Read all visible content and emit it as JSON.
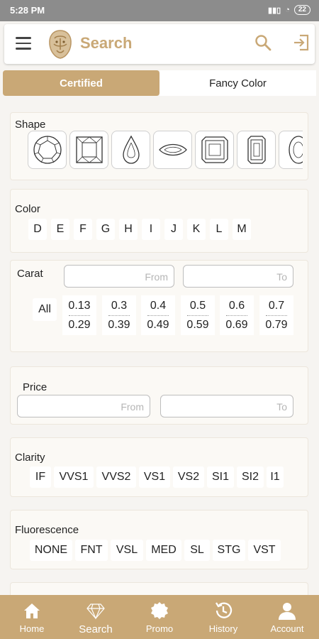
{
  "status": {
    "time": "5:28 PM",
    "battery": "22"
  },
  "header": {
    "title": "Search"
  },
  "tabs": [
    {
      "label": "Certified",
      "active": true
    },
    {
      "label": "Fancy Color",
      "active": false
    }
  ],
  "shape": {
    "label": "Shape",
    "items": [
      "round-icon",
      "princess-icon",
      "pear-icon",
      "marquise-icon",
      "asscher-icon",
      "emerald-icon",
      "oval-icon"
    ]
  },
  "color": {
    "label": "Color",
    "options": [
      "D",
      "E",
      "F",
      "G",
      "H",
      "I",
      "J",
      "K",
      "L",
      "M"
    ]
  },
  "carat": {
    "label": "Carat",
    "from_placeholder": "From",
    "to_placeholder": "To",
    "all_label": "All",
    "ranges": [
      {
        "from": "0.13",
        "to": "0.29"
      },
      {
        "from": "0.3",
        "to": "0.39"
      },
      {
        "from": "0.4",
        "to": "0.49"
      },
      {
        "from": "0.5",
        "to": "0.59"
      },
      {
        "from": "0.6",
        "to": "0.69"
      },
      {
        "from": "0.7",
        "to": "0.79"
      }
    ]
  },
  "price": {
    "label": "Price",
    "from_placeholder": "From",
    "to_placeholder": "To"
  },
  "clarity": {
    "label": "Clarity",
    "options": [
      "IF",
      "VVS1",
      "VVS2",
      "VS1",
      "VS2",
      "SI1",
      "SI2",
      "I1"
    ]
  },
  "fluorescence": {
    "label": "Fluorescence",
    "options": [
      "NONE",
      "FNT",
      "VSL",
      "MED",
      "SL",
      "STG",
      "VST"
    ]
  },
  "nav": [
    {
      "label": "Home",
      "icon": "home-icon",
      "active": false
    },
    {
      "label": "Search",
      "icon": "diamond-icon",
      "active": true
    },
    {
      "label": "Promo",
      "icon": "promo-icon",
      "active": false
    },
    {
      "label": "History",
      "icon": "history-icon",
      "active": false
    },
    {
      "label": "Account",
      "icon": "account-icon",
      "active": false
    }
  ],
  "colors": {
    "accent": "#c9a876",
    "statusbar": "#8c8c8c",
    "background": "#f6f4f1"
  }
}
